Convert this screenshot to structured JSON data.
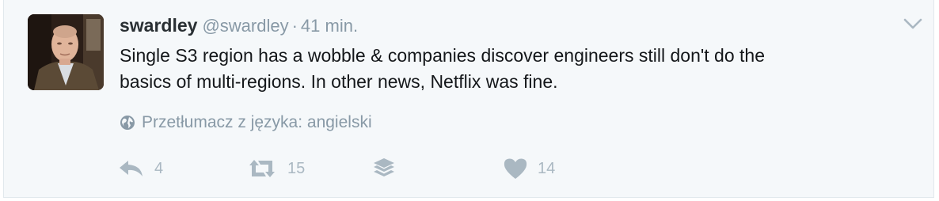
{
  "tweet": {
    "fullname": "swardley",
    "username": "@swardley",
    "separator": "·",
    "timestamp": "41 min.",
    "text_line1": "Single S3 region has a wobble & companies discover engineers still don't do the",
    "text_line2": "basics of multi-regions. In other news, Netflix was fine.",
    "translate_label": "Przetłumacz z języka: angielski",
    "actions": {
      "reply_count": "4",
      "retweet_count": "15",
      "like_count": "14"
    },
    "icons": {
      "more": "chevron-down-icon",
      "translate": "globe-icon",
      "reply": "reply-icon",
      "retweet": "retweet-icon",
      "buffer": "layers-icon",
      "like": "heart-icon"
    }
  },
  "colors": {
    "background": "#f5f8fa",
    "text": "#14171a",
    "muted": "#8899a6",
    "action_icon": "#aab8c2"
  }
}
